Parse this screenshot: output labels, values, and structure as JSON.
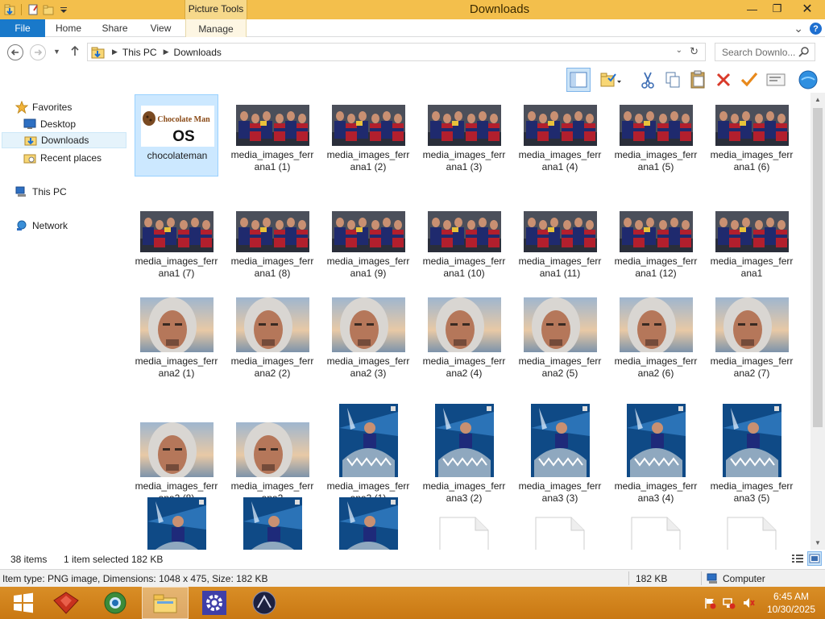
{
  "window": {
    "title": "Downloads",
    "context_tab_group": "Picture Tools",
    "minimize": "—",
    "restore": "❐",
    "close": "✕"
  },
  "ribbon": {
    "tabs": [
      "File",
      "Home",
      "Share",
      "View",
      "Manage"
    ],
    "expand_glyph": "⌄",
    "help_glyph": "?"
  },
  "address": {
    "path": [
      "This PC",
      "Downloads"
    ],
    "search_placeholder": "Search Downlo..."
  },
  "nav_pane": {
    "favorites_label": "Favorites",
    "favorites": [
      "Desktop",
      "Downloads",
      "Recent places"
    ],
    "this_pc": "This PC",
    "network": "Network",
    "selected": "Downloads"
  },
  "files": [
    {
      "name": "chocolateman",
      "kind": "logo"
    },
    {
      "name": "media_images_ferrana1 (1)",
      "kind": "team"
    },
    {
      "name": "media_images_ferrana1 (2)",
      "kind": "team"
    },
    {
      "name": "media_images_ferrana1 (3)",
      "kind": "team"
    },
    {
      "name": "media_images_ferrana1 (4)",
      "kind": "team"
    },
    {
      "name": "media_images_ferrana1 (5)",
      "kind": "team"
    },
    {
      "name": "media_images_ferrana1 (6)",
      "kind": "team"
    },
    {
      "name": "media_images_ferrana1 (7)",
      "kind": "team"
    },
    {
      "name": "media_images_ferrana1 (8)",
      "kind": "team"
    },
    {
      "name": "media_images_ferrana1 (9)",
      "kind": "team"
    },
    {
      "name": "media_images_ferrana1 (10)",
      "kind": "team"
    },
    {
      "name": "media_images_ferrana1 (11)",
      "kind": "team"
    },
    {
      "name": "media_images_ferrana1 (12)",
      "kind": "team"
    },
    {
      "name": "media_images_ferrana1",
      "kind": "team"
    },
    {
      "name": "media_images_ferrana2 (1)",
      "kind": "hood"
    },
    {
      "name": "media_images_ferrana2 (2)",
      "kind": "hood"
    },
    {
      "name": "media_images_ferrana2 (3)",
      "kind": "hood"
    },
    {
      "name": "media_images_ferrana2 (4)",
      "kind": "hood"
    },
    {
      "name": "media_images_ferrana2 (5)",
      "kind": "hood"
    },
    {
      "name": "media_images_ferrana2 (6)",
      "kind": "hood"
    },
    {
      "name": "media_images_ferrana2 (7)",
      "kind": "hood"
    },
    {
      "name": "media_images_ferrana2 (8)",
      "kind": "hood"
    },
    {
      "name": "media_images_ferrana2",
      "kind": "hood"
    },
    {
      "name": "media_images_ferrana3 (1)",
      "kind": "shark"
    },
    {
      "name": "media_images_ferrana3 (2)",
      "kind": "shark"
    },
    {
      "name": "media_images_ferrana3 (3)",
      "kind": "shark"
    },
    {
      "name": "media_images_ferrana3 (4)",
      "kind": "shark"
    },
    {
      "name": "media_images_ferrana3 (5)",
      "kind": "shark"
    },
    {
      "name": "",
      "kind": "shark"
    },
    {
      "name": "",
      "kind": "shark"
    },
    {
      "name": "",
      "kind": "shark"
    },
    {
      "name": "",
      "kind": "blank"
    },
    {
      "name": "",
      "kind": "blank"
    },
    {
      "name": "",
      "kind": "blank"
    },
    {
      "name": "",
      "kind": "blank"
    }
  ],
  "logo_text": {
    "line1": "Chocolate Man",
    "line2": "OS"
  },
  "selected_file": "chocolateman",
  "status": {
    "item_count": "38 items",
    "selection": "1 item selected",
    "selection_size": "182 KB"
  },
  "details": {
    "info": "Item type: PNG image, Dimensions: 1048 x 475, Size: 182 KB",
    "size": "182 KB",
    "location": "Computer"
  },
  "clock": {
    "time": "6:45 AM",
    "date": "10/30/2025"
  },
  "colors": {
    "titlebar": "#f3bf4c",
    "file_tab": "#1979ca",
    "taskbar": "#d18520",
    "selection": "#cce8ff"
  }
}
